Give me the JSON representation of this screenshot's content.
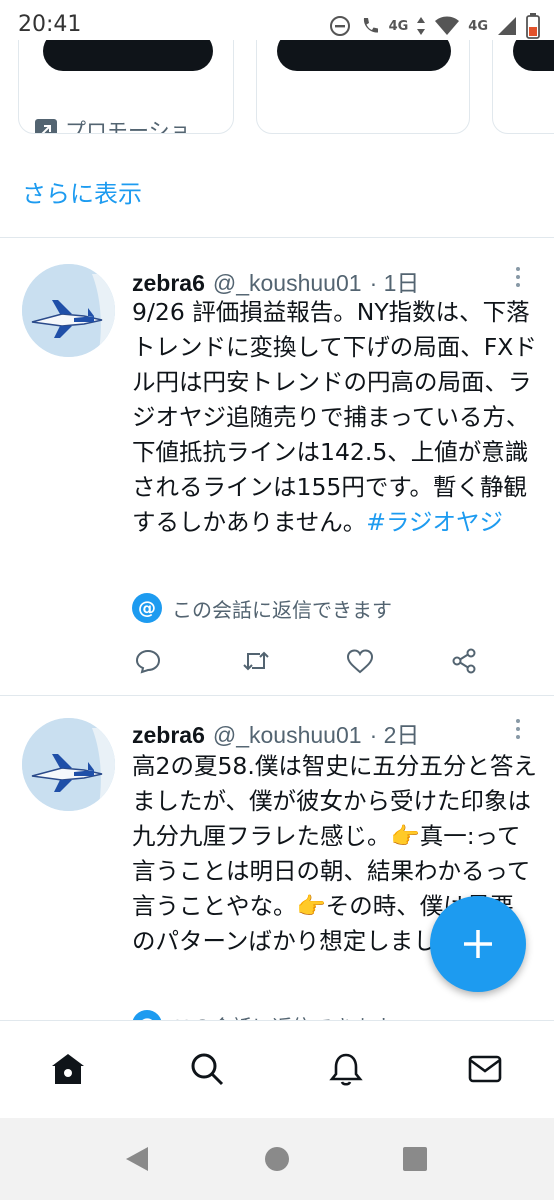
{
  "status_bar": {
    "time": "20:41",
    "network_left": "4G",
    "network_right": "4G"
  },
  "promo": {
    "label": "プロモーショ…",
    "icon": "arrow-up-right-icon"
  },
  "timeline": {
    "show_more": "さらに表示"
  },
  "tweets": [
    {
      "name": "zebra6",
      "handle": "@_koushuu01",
      "time": "· 1日",
      "text": "9/26 評価損益報告。NY指数は、下落トレンドに変換して下げの局面、FXドル円は円安トレンドの円高の局面、ラジオヤジ追随売りで捕まっている方、下値抵抗ラインは142.5、上値が意識されるラインは155円です。暫く静観するしかありません。",
      "hashtag": "#ラジオヤジ",
      "reply_note": "この会話に返信できます",
      "avatar": "jet-airplane-avatar"
    },
    {
      "name": "zebra6",
      "handle": "@_koushuu01",
      "time": "· 2日",
      "text": "高2の夏58.僕は智史に五分五分と答えましたが、僕が彼女から受けた印象は九分九厘フラレた感じ。👉真一:って言うことは明日の朝、結果わかるって言うことやな。👉その時、僕は最悪のパターンばかり想定しました。",
      "reply_note": "この会話に返信できます",
      "avatar": "jet-airplane-avatar"
    }
  ],
  "colors": {
    "accent": "#1d9bf0",
    "text": "#0f1419",
    "muted": "#536471"
  }
}
